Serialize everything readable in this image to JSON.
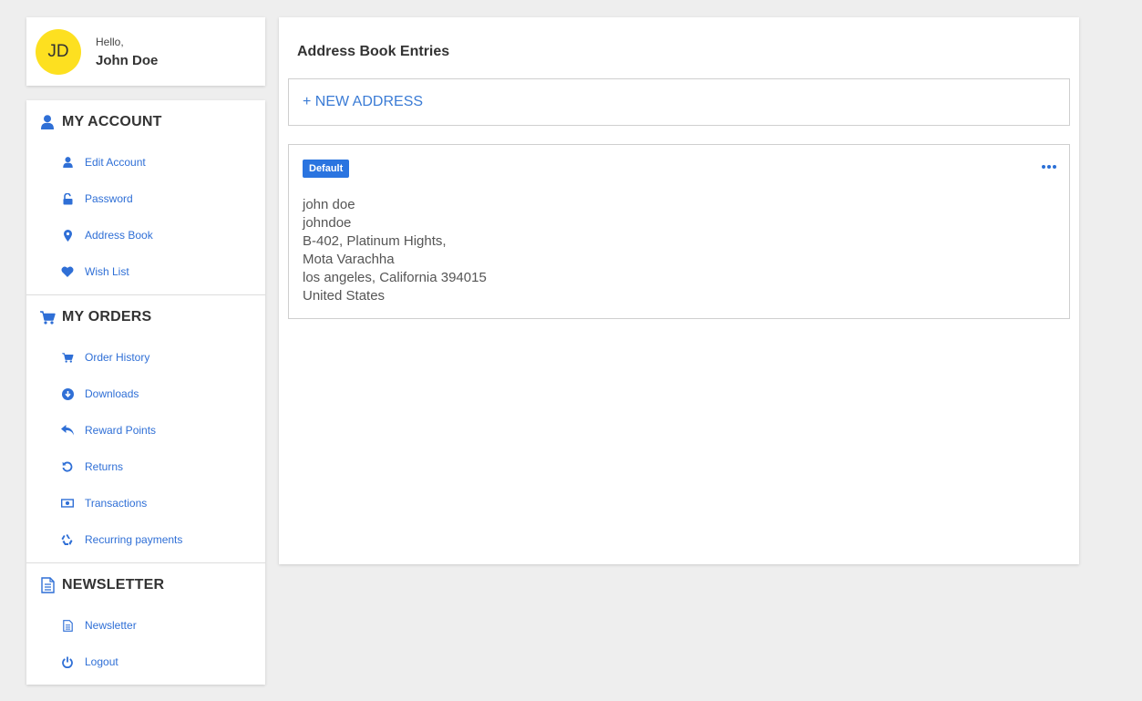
{
  "user": {
    "initials": "JD",
    "greeting": "Hello,",
    "name": "John Doe"
  },
  "sidebar": {
    "account": {
      "title": "MY ACCOUNT",
      "items": [
        {
          "label": "Edit Account",
          "icon": "user-icon"
        },
        {
          "label": "Password",
          "icon": "unlock-icon"
        },
        {
          "label": "Address Book",
          "icon": "map-marker-icon"
        },
        {
          "label": "Wish List",
          "icon": "heart-icon"
        }
      ]
    },
    "orders": {
      "title": "MY ORDERS",
      "items": [
        {
          "label": "Order History",
          "icon": "cart-icon"
        },
        {
          "label": "Downloads",
          "icon": "download-icon"
        },
        {
          "label": "Reward Points",
          "icon": "reply-icon"
        },
        {
          "label": "Returns",
          "icon": "undo-icon"
        },
        {
          "label": "Transactions",
          "icon": "money-icon"
        },
        {
          "label": "Recurring payments",
          "icon": "recycle-icon"
        }
      ]
    },
    "newsletter": {
      "title": "NEWSLETTER",
      "items": [
        {
          "label": "Newsletter",
          "icon": "document-icon"
        },
        {
          "label": "Logout",
          "icon": "power-icon"
        }
      ]
    }
  },
  "main": {
    "title": "Address Book Entries",
    "new_address_label": "+ NEW ADDRESS",
    "entries": [
      {
        "badge": "Default",
        "lines": [
          "john doe",
          "johndoe",
          "B-402, Platinum Hights,",
          "Mota Varachha",
          "los angeles, California 394015",
          "United States"
        ]
      }
    ]
  },
  "colors": {
    "accent": "#2a74e0",
    "link": "#2f6fd6",
    "avatar": "#fde020",
    "background": "#eeeeee"
  }
}
